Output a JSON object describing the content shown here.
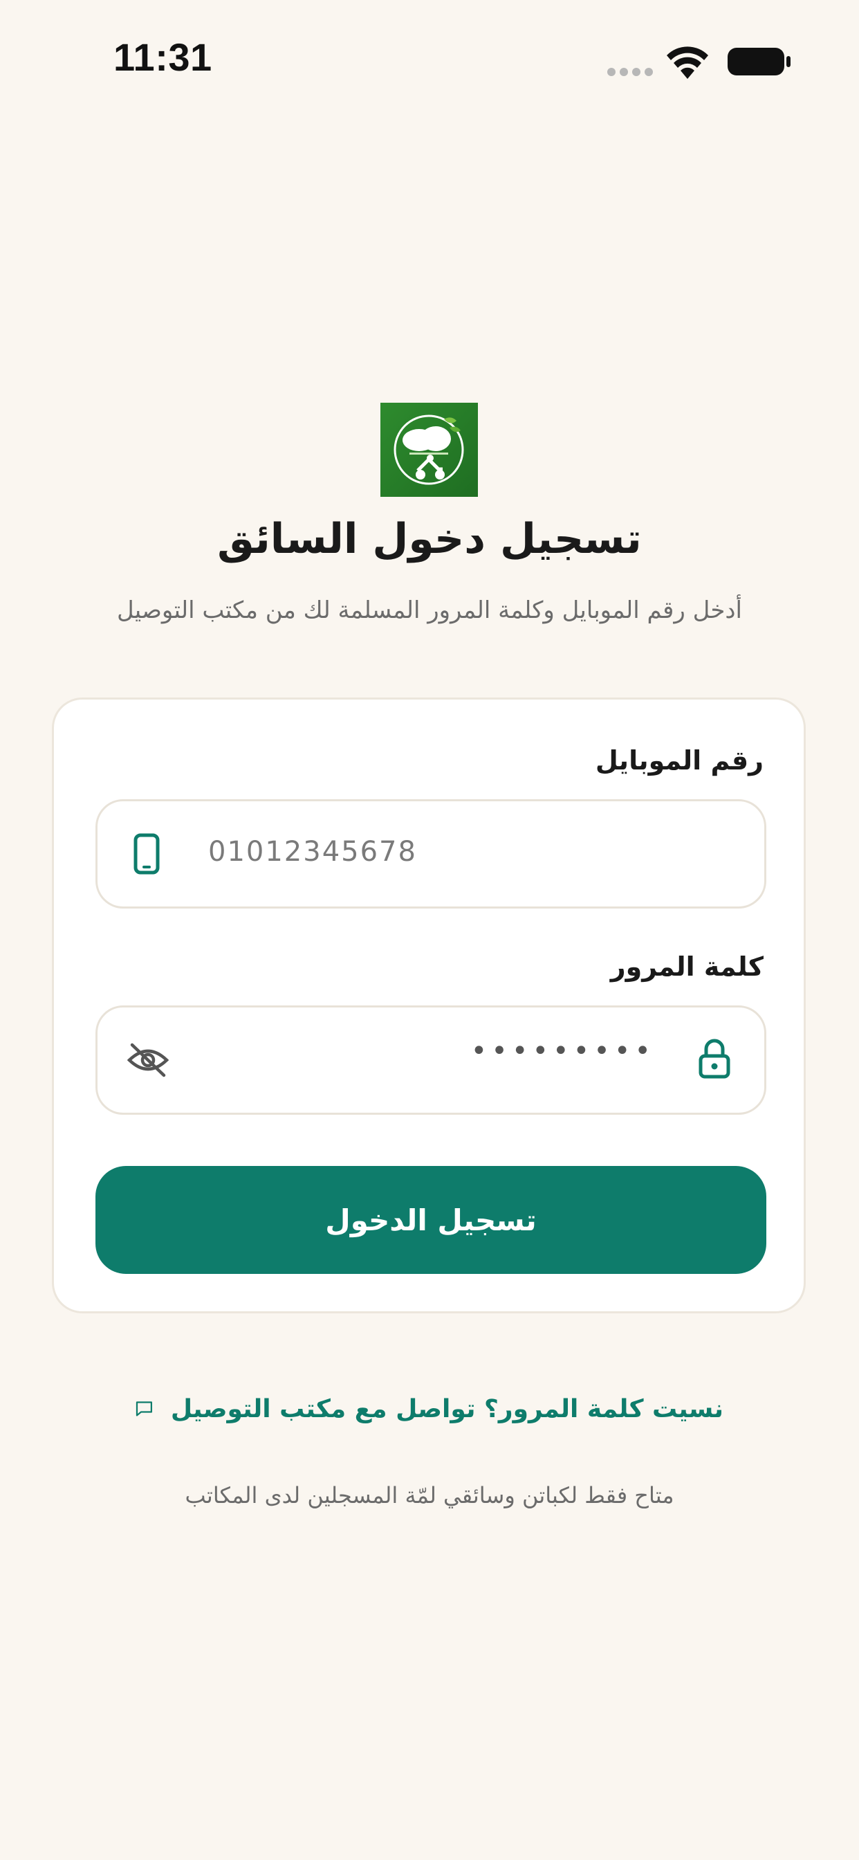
{
  "status_bar": {
    "time": "11:31"
  },
  "header": {
    "logo_icon": "lamma-brand-logo",
    "title": "تسجيل دخول السائق",
    "subtitle": "أدخل رقم الموبايل وكلمة المرور المسلمة لك من مكتب التوصيل"
  },
  "form": {
    "phone": {
      "label": "رقم الموبايل",
      "placeholder": "01012345678",
      "icon": "smartphone-icon"
    },
    "password": {
      "label": "كلمة المرور",
      "masked_value": "•••••••••",
      "lock_icon": "lock-icon",
      "visibility_icon": "eye-off-icon"
    },
    "submit_label": "تسجيل الدخول"
  },
  "footer": {
    "forgot_link": "نسيت كلمة المرور؟ تواصل مع مكتب التوصيل",
    "forgot_icon": "message-icon",
    "note": "متاح فقط لكباتن وسائقي لمّة المسجلين لدى المكاتب"
  },
  "colors": {
    "background": "#FAF6F0",
    "primary": "#0E7C6B",
    "card": "#FFFFFF",
    "logo_green": "#2E8B2E"
  }
}
